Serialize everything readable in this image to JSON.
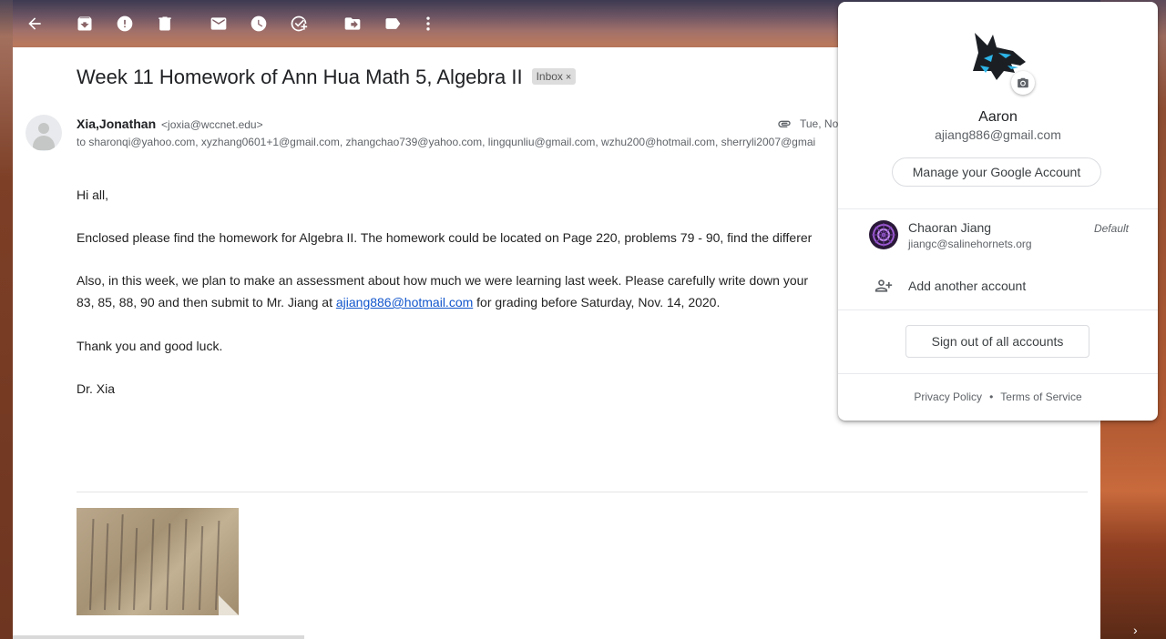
{
  "toolbar": {
    "icons": [
      "back-arrow-icon",
      "archive-icon",
      "report-spam-icon",
      "delete-icon",
      "mark-unread-icon",
      "snooze-icon",
      "add-to-tasks-icon",
      "move-to-icon",
      "labels-icon",
      "more-icon"
    ]
  },
  "email": {
    "subject": "Week 11 Homework of Ann Hua Math 5, Algebra II",
    "label_chip": "Inbox",
    "label_chip_close": "×",
    "sender_name": "Xia,Jonathan",
    "sender_email": "<joxia@wccnet.edu>",
    "date": "Tue, No",
    "to_line": "to sharonqi@yahoo.com, xyzhang0601+1@gmail.com, zhangchao739@yahoo.com, lingqunliu@gmail.com, wzhu200@hotmail.com, sherryli2007@gmai",
    "greeting": "Hi all,",
    "para1": "Enclosed please find the homework for Algebra II. The homework could be located on Page 220, problems 79 - 90, find the differer",
    "para2_line1": "Also, in this week,  we plan to make an assessment about how much we were learning last week. Please carefully write down your",
    "para2_line2_pre": "83, 85, 88, 90 and then submit to Mr. Jiang at ",
    "para2_link": "ajiang886@hotmail.com",
    "para2_line2_post": " for grading before Saturday, Nov. 14, 2020.",
    "para3": "Thank you and good luck.",
    "signature": "Dr. Xia"
  },
  "account_menu": {
    "name": "Aaron",
    "email": "ajiang886@gmail.com",
    "manage_button": "Manage your Google Account",
    "other_account": {
      "name": "Chaoran Jiang",
      "email": "jiangc@salinehornets.org",
      "tag": "Default"
    },
    "add_account": "Add another account",
    "sign_out": "Sign out of all accounts",
    "privacy": "Privacy Policy",
    "separator": "•",
    "terms": "Terms of Service"
  }
}
